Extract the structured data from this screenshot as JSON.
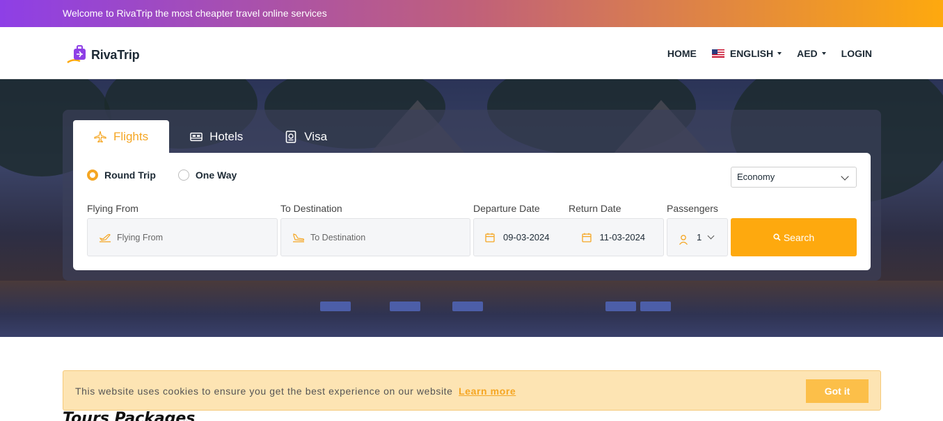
{
  "topbar": {
    "welcome": "Welcome to RivaTrip the most cheapter travel online services"
  },
  "brand": {
    "name": "RivaTrip",
    "logo_icon": "suitcase-plane-icon",
    "accent": "#fea90e",
    "purple": "#8e3fe6"
  },
  "nav": {
    "home": "HOME",
    "language": "ENGLISH",
    "currency": "AED",
    "login": "LOGIN"
  },
  "tabs": [
    {
      "label": "Flights",
      "icon": "plane-icon",
      "active": true
    },
    {
      "label": "Hotels",
      "icon": "bed-icon",
      "active": false
    },
    {
      "label": "Visa",
      "icon": "passport-icon",
      "active": false
    }
  ],
  "trip_type": {
    "round_trip": "Round Trip",
    "one_way": "One Way",
    "selected": "Round Trip"
  },
  "cabin_class": {
    "selected": "Economy"
  },
  "form": {
    "from_label": "Flying From",
    "from_placeholder": "Flying From",
    "to_label": "To Destination",
    "to_placeholder": "To Destination",
    "departure_label": "Departure Date",
    "departure_value": "09-03-2024",
    "return_label": "Return Date",
    "return_value": "11-03-2024",
    "passengers_label": "Passengers",
    "passengers_value": "1",
    "search_label": "Search"
  },
  "section": {
    "tours_title": "Tours Packages"
  },
  "cookie": {
    "text": "This website uses cookies to ensure you get the best experience on our website",
    "link": "Learn more",
    "button": "Got it"
  }
}
